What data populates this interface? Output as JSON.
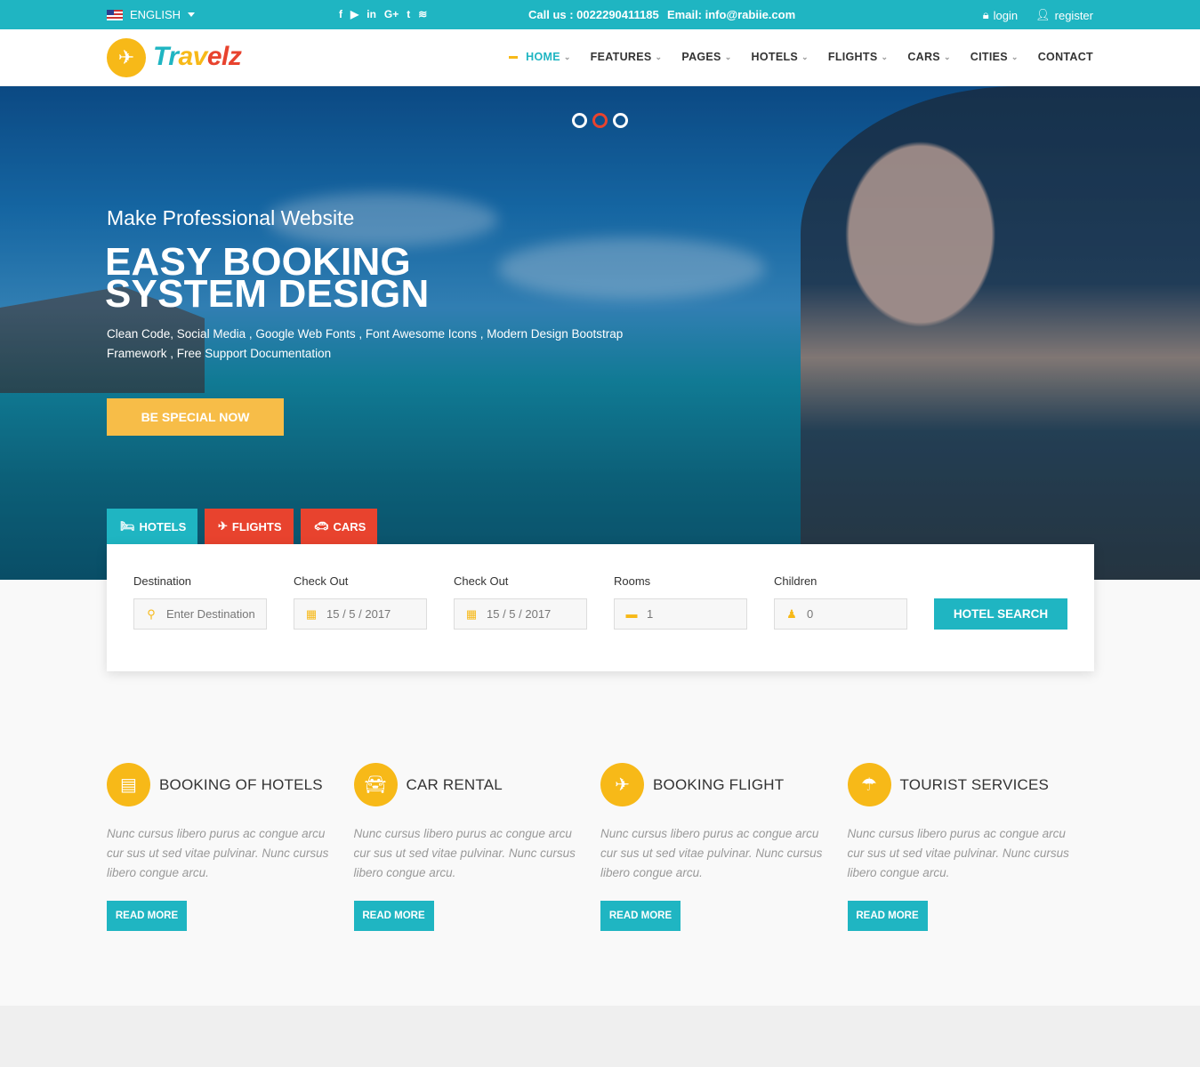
{
  "topbar": {
    "language": "ENGLISH",
    "socials": [
      "f",
      "▶",
      "in",
      "G+",
      "t",
      "≋"
    ],
    "phone": "Call us : 0022290411185",
    "email": "Email: info@rabiie.com",
    "login": "login",
    "register": "register"
  },
  "brand": {
    "parts": [
      "Tr",
      "av",
      "elz"
    ],
    "colors": {
      "primary": "#1fb5c2",
      "accent": "#f7b918",
      "red": "#e8432e"
    }
  },
  "nav": {
    "items": [
      "HOME",
      "FEATURES",
      "PAGES",
      "HOTELS",
      "FLIGHTS",
      "CARS",
      "CITIES",
      "CONTACT"
    ]
  },
  "hero": {
    "subtitle": "Make Professional Website",
    "title_line1": "EASY BOOKING",
    "title_line2": "SYSTEM DESIGN",
    "description_line1": "Clean Code, Social Media , Google Web Fonts , Font Awesome Icons , Modern Design Bootstrap",
    "description_line2": "Framework , Free Support Documentation",
    "cta": "BE SPECIAL NOW",
    "slides": 3,
    "active_slide": 2
  },
  "search_tabs": [
    "HOTELS",
    "FLIGHTS",
    "CARS"
  ],
  "search": {
    "destination_label": "Destination",
    "destination_placeholder": "Enter Destination",
    "checkin_label": "Check Out",
    "checkin_value": "15 / 5 / 2017",
    "checkout_label": "Check Out",
    "checkout_value": "15 / 5 / 2017",
    "rooms_label": "Rooms",
    "rooms_value": "1",
    "children_label": "Children",
    "children_value": "0",
    "button": "HOTEL SEARCH"
  },
  "services": [
    {
      "title": "BOOKING OF HOTELS",
      "icon": "building-icon",
      "text": "Nunc cursus libero purus ac congue arcu cur sus ut sed vitae pulvinar. Nunc cursus libero congue arcu.",
      "button": "READ MORE"
    },
    {
      "title": "CAR RENTAL",
      "icon": "car-icon",
      "text": "Nunc cursus libero purus ac congue arcu cur sus ut sed vitae pulvinar. Nunc cursus libero congue arcu.",
      "button": "READ MORE"
    },
    {
      "title": "BOOKING FLIGHT",
      "icon": "plane-icon",
      "text": "Nunc cursus libero purus ac congue arcu cur sus ut sed vitae pulvinar. Nunc cursus libero congue arcu.",
      "button": "READ MORE"
    },
    {
      "title": "TOURIST SERVICES",
      "icon": "umbrella-icon",
      "text": "Nunc cursus libero purus ac congue arcu cur sus ut sed vitae pulvinar. Nunc cursus libero congue arcu.",
      "button": "READ MORE"
    }
  ]
}
